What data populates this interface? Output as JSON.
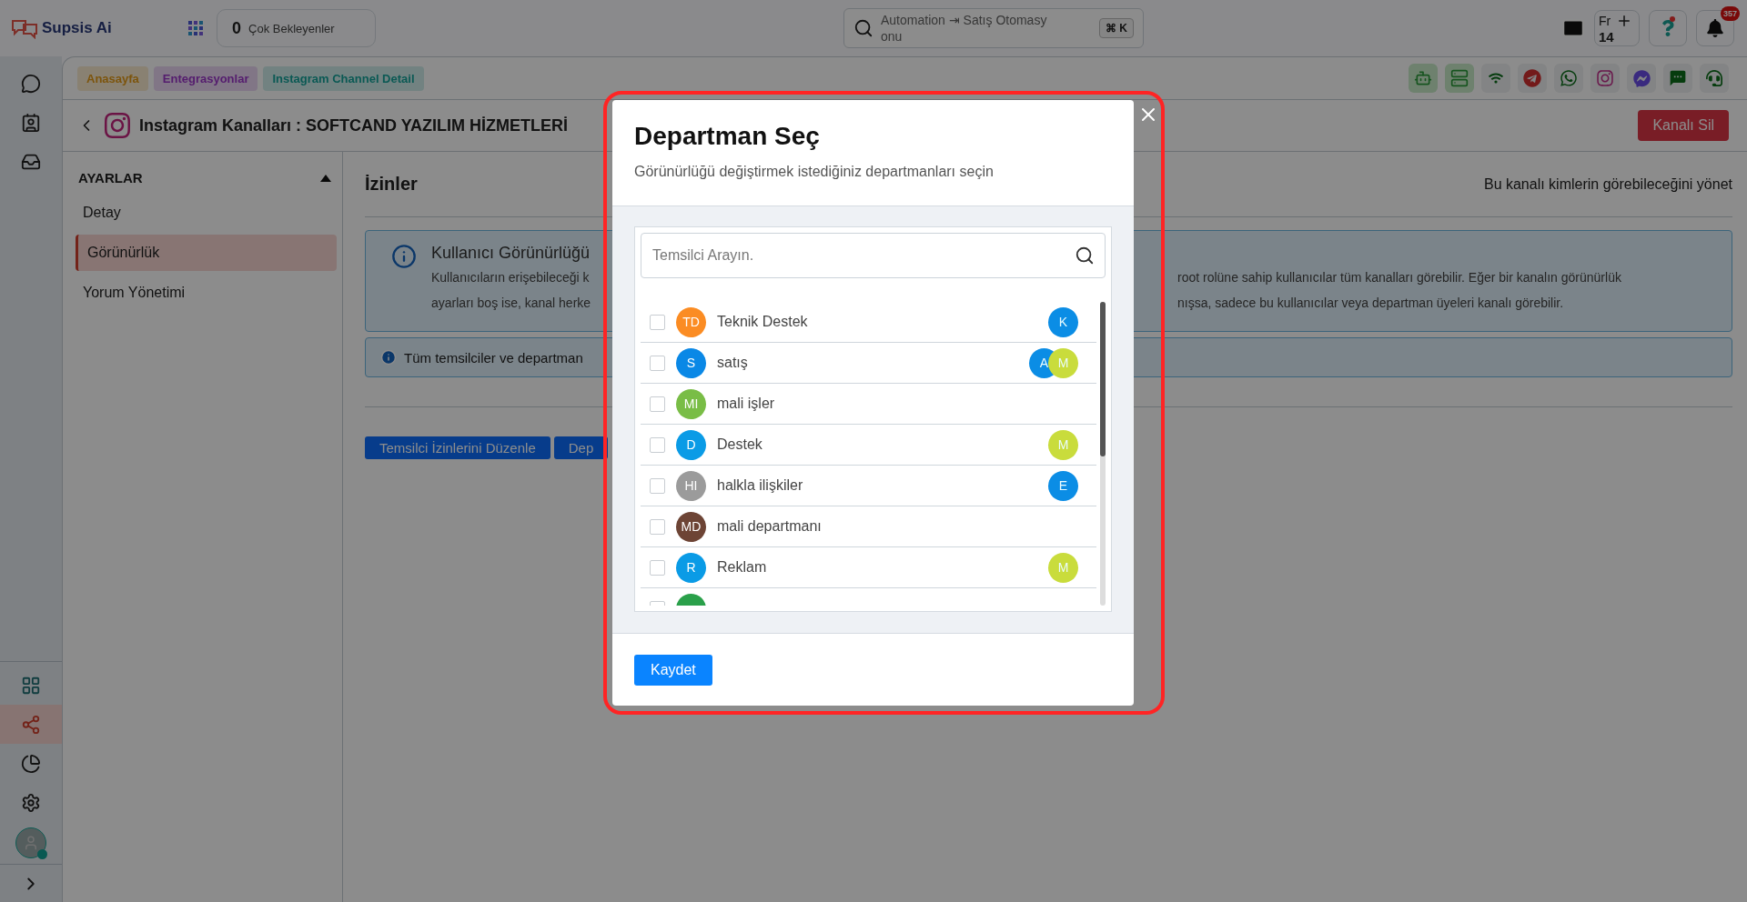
{
  "topbar": {
    "logo": "Supsis Ai",
    "waiting": {
      "count": "0",
      "label": "Çok Bekleyenler"
    },
    "search": {
      "value": "Automation ⇥ Satış Otomasyonu",
      "shortcut": "⌘ K"
    },
    "calendar": {
      "day": "Fr",
      "date": "14"
    },
    "notifications": {
      "count": "357"
    }
  },
  "rail": {
    "top": [
      {
        "kind": "chat",
        "selected": false
      },
      {
        "kind": "contacts",
        "selected": false
      },
      {
        "kind": "inbox",
        "selected": false
      }
    ],
    "bottom": [
      {
        "kind": "apps",
        "selected": false
      },
      {
        "kind": "share",
        "selected": true
      },
      {
        "kind": "chart",
        "selected": false
      },
      {
        "kind": "settings",
        "selected": false
      }
    ],
    "profile": {
      "online": true
    }
  },
  "breadcrumbs": [
    {
      "label": "Anasayfa",
      "kind": "home"
    },
    {
      "label": "Entegrasyonlar",
      "kind": "integrations"
    },
    {
      "label": "Instagram Channel Detail",
      "kind": "detail"
    }
  ],
  "channels": [
    {
      "kind": "robot",
      "highlighted": true
    },
    {
      "kind": "server",
      "highlighted": true
    },
    {
      "kind": "wifi",
      "highlighted": false
    },
    {
      "kind": "paper-plane",
      "highlighted": false
    },
    {
      "kind": "phone-bubble",
      "highlighted": false
    },
    {
      "kind": "camera",
      "highlighted": false
    },
    {
      "kind": "messenger",
      "highlighted": false
    },
    {
      "kind": "sms",
      "highlighted": false
    },
    {
      "kind": "headset",
      "highlighted": false
    }
  ],
  "header": {
    "title": "Instagram Kanalları : SOFTCAND YAZILIM HİZMETLERİ",
    "delete_button": "Kanalı Sil"
  },
  "settings": {
    "heading": "AYARLAR",
    "expanded": true,
    "items": [
      {
        "label": "Detay",
        "selected": false
      },
      {
        "label": "Görünürlük",
        "selected": true
      },
      {
        "label": "Yorum Yönetimi",
        "selected": false
      }
    ]
  },
  "permissions": {
    "title": "İzinler",
    "subtitle": "Bu kanalı kimlerin görebileceğini yönet",
    "info": {
      "title": "Kullanıcı Görünürlüğü",
      "lines": [
        {
          "left": "Kullanıcıların erişebileceği k",
          "right": "root rolüne sahip kullanıcılar tüm kanalları görebilir. Eğer bir kanalın görünürlük"
        },
        {
          "left": "ayarları boş ise, kanal herke",
          "right": "nışsa, sadece bu kullanıcılar veya departman üyeleri kanalı görebilir."
        }
      ]
    },
    "notice": "Tüm temsilciler ve departman",
    "buttons": [
      "Temsilci İzinlerini Düzenle",
      "Dep"
    ]
  },
  "modal": {
    "title": "Departman Seç",
    "subtitle": "Görünürlüğü değiştirmek istediğiniz departmanları seçin",
    "search": {
      "placeholder": "Temsilci Arayın."
    },
    "departments": [
      {
        "initials": "TD",
        "name": "Teknik Destek",
        "color": "#fb8c23",
        "checked": false,
        "members": [
          {
            "initial": "K",
            "color": "#0b8de5"
          }
        ]
      },
      {
        "initials": "S",
        "name": "satış",
        "color": "#0a88e6",
        "checked": false,
        "members": [
          {
            "initial": "A",
            "color": "#0b8de5"
          },
          {
            "initial": "M",
            "color": "#c9dc3c"
          }
        ]
      },
      {
        "initials": "MI",
        "name": "mali işler",
        "color": "#79bd46",
        "checked": false
      },
      {
        "initials": "D",
        "name": "Destek",
        "color": "#0a9be6",
        "checked": false,
        "members": [
          {
            "initial": "M",
            "color": "#c9dc3c"
          }
        ]
      },
      {
        "initials": "HI",
        "name": "halkla ilişkiler",
        "color": "#9b9b9b",
        "checked": false,
        "members": [
          {
            "initial": "E",
            "color": "#0b8de5"
          }
        ]
      },
      {
        "initials": "MD",
        "name": "mali departmanı",
        "color": "#6d4435",
        "checked": false
      },
      {
        "initials": "R",
        "name": "Reklam",
        "color": "#0a9be6",
        "checked": false,
        "members": [
          {
            "initial": "M",
            "color": "#c9dc3c"
          }
        ]
      },
      {
        "color": "#2aa04a",
        "checked": false
      }
    ],
    "save_button": "Kaydet"
  }
}
